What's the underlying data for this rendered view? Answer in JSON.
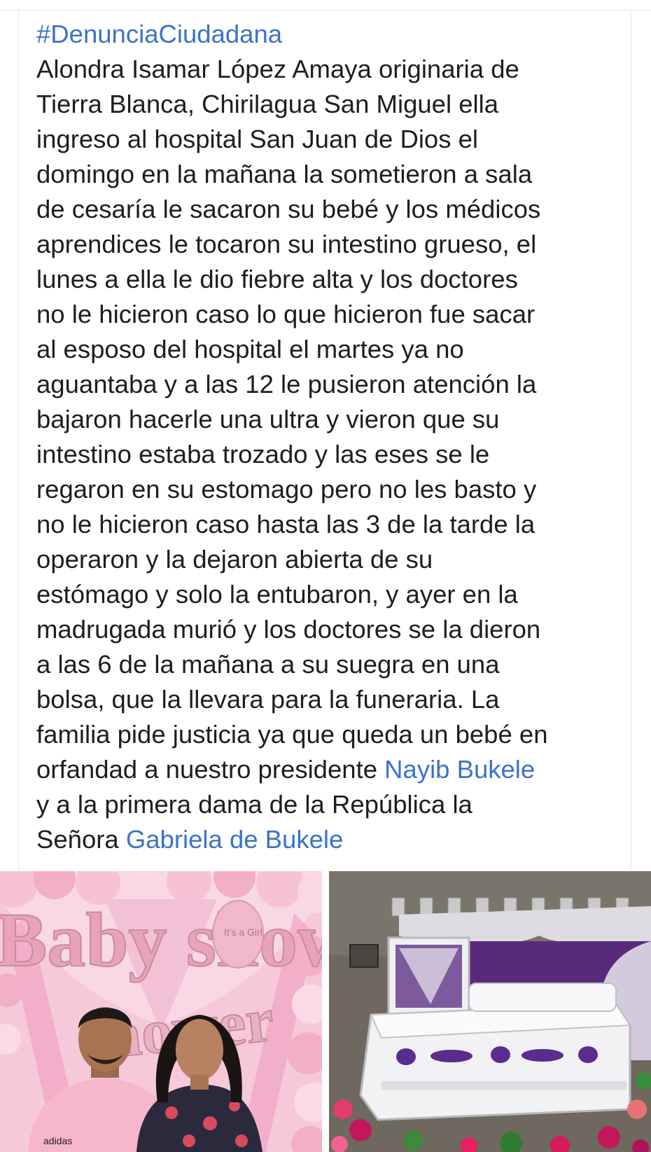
{
  "post": {
    "hashtag": "#DenunciaCiudadana",
    "body_part1": "Alondra Isamar López Amaya originaria de\nTierra Blanca, Chirilagua San Miguel ella\ningreso al hospital San Juan de Dios el\ndomingo en la mañana la sometieron a sala\nde cesaría le sacaron su bebé y los médicos\naprendices le tocaron su intestino grueso, el\nlunes a ella le dio fiebre alta y los doctores\nno le hicieron caso lo que hicieron fue sacar\nal esposo del hospital el martes ya no\naguantaba y a las 12 le pusieron atención la\nbajaron hacerle una ultra y vieron que su\nintestino estaba trozado y las eses se le\nregaron en su estomago pero no les basto y\nno le hicieron caso hasta las 3 de la tarde la\noperaron y la dejaron abierta de su\nestómago y solo la entubaron, y ayer en la\nmadrugada murió y los doctores se la dieron\na las 6 de la mañana a su suegra en una\nbolsa, que la llevara para la funeraria. La\nfamilia pide justicia ya que queda un bebé en\norfandad a nuestro presidente ",
    "mention1": "Nayib Bukele",
    "body_part2": "\ny a la primera dama de la República la\nSeñora ",
    "mention2": "Gabriela de Bukele"
  },
  "photos": {
    "left": {
      "balloon_text": "Baby shower",
      "foot_balloon_text": "It's a Girl",
      "shirt_logo": "adidas"
    },
    "right": {}
  },
  "colors": {
    "link": "#3b73c7",
    "text": "#1c1e21",
    "pink": "#f4b4cc",
    "casket_purple": "#6b2a8a"
  }
}
